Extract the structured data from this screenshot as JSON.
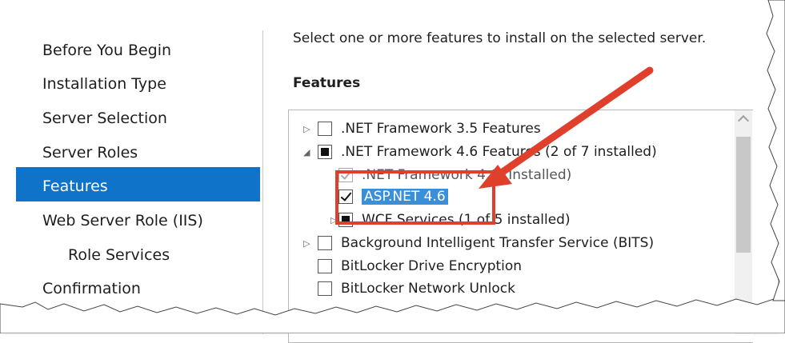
{
  "nav": {
    "items": [
      {
        "label": "Before You Begin"
      },
      {
        "label": "Installation Type"
      },
      {
        "label": "Server Selection"
      },
      {
        "label": "Server Roles"
      },
      {
        "label": "Features"
      },
      {
        "label": "Web Server Role (IIS)"
      },
      {
        "label": "Role Services"
      },
      {
        "label": "Confirmation"
      }
    ],
    "selected": "Features"
  },
  "main": {
    "instruction": "Select one or more features to install on the selected server.",
    "features_heading": "Features",
    "tree": [
      {
        "label": ".NET Framework 3.5 Features",
        "expander": "▷",
        "state": "unchecked"
      },
      {
        "label": ".NET Framework 4.6 Features (2 of 7 installed)",
        "expander": "◢",
        "state": "partial"
      },
      {
        "label": ".NET Framework 4.6 (Installed)",
        "expander": "",
        "state": "installed"
      },
      {
        "label": "ASP.NET 4.6",
        "expander": "",
        "state": "checked",
        "selected": true
      },
      {
        "label": "WCF Services (1 of 5 installed)",
        "expander": "▷",
        "state": "partial"
      },
      {
        "label": "Background Intelligent Transfer Service (BITS)",
        "expander": "▷",
        "state": "unchecked"
      },
      {
        "label": "BitLocker Drive Encryption",
        "expander": "",
        "state": "unchecked"
      },
      {
        "label": "BitLocker Network Unlock",
        "expander": "",
        "state": "unchecked"
      }
    ]
  },
  "colors": {
    "nav_selected": "#0f73c9",
    "tree_selected": "#3b8fd9",
    "annotation": "#e0402b"
  },
  "icons": {
    "expander_collapsed": "triangle-right-icon",
    "expander_expanded": "triangle-down-icon",
    "scroll_up": "chevron-up-icon"
  }
}
